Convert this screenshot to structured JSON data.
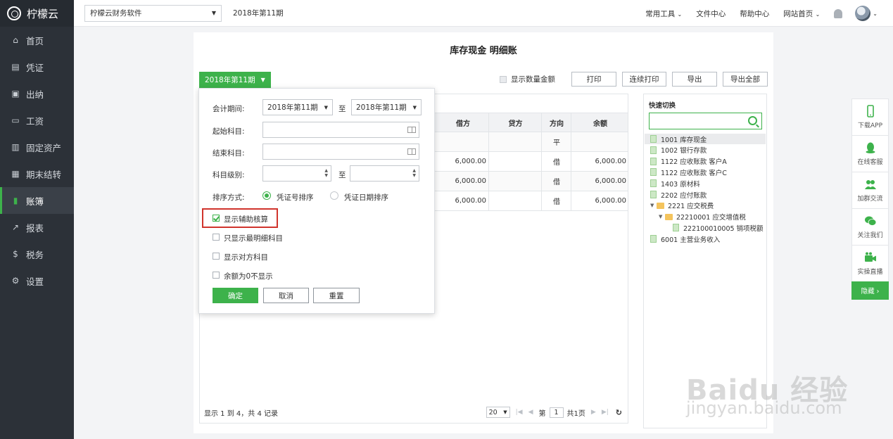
{
  "app": {
    "name": "柠檬云"
  },
  "sidebar": {
    "items": [
      {
        "label": "首页",
        "icon": "home-icon",
        "glyph": "⌂"
      },
      {
        "label": "凭证",
        "icon": "voucher-icon",
        "glyph": "▤"
      },
      {
        "label": "出纳",
        "icon": "cashier-icon",
        "glyph": "▣"
      },
      {
        "label": "工资",
        "icon": "salary-icon",
        "glyph": "▭"
      },
      {
        "label": "固定资产",
        "icon": "fixed-asset-icon",
        "glyph": "▥"
      },
      {
        "label": "期末结转",
        "icon": "period-end-icon",
        "glyph": "▦"
      },
      {
        "label": "账簿",
        "icon": "ledger-icon",
        "glyph": "▮"
      },
      {
        "label": "报表",
        "icon": "report-icon",
        "glyph": "↗"
      },
      {
        "label": "税务",
        "icon": "tax-icon",
        "glyph": "$"
      },
      {
        "label": "设置",
        "icon": "settings-icon",
        "glyph": "⚙"
      }
    ],
    "active_index": 6
  },
  "topbar": {
    "company": "柠檬云财务软件",
    "period": "2018年第11期",
    "links": [
      "常用工具",
      "文件中心",
      "帮助中心",
      "网站首页"
    ]
  },
  "page": {
    "title": "库存现金 明细账",
    "period_button": "2018年第11期",
    "show_qty_label": "显示数量金额",
    "buttons": [
      "打印",
      "连续打印",
      "导出",
      "导出全部"
    ]
  },
  "table": {
    "headers": [
      "借方",
      "贷方",
      "方向",
      "余额"
    ],
    "rows": [
      [
        "",
        "",
        "平",
        ""
      ],
      [
        "6,000.00",
        "",
        "借",
        "6,000.00"
      ],
      [
        "6,000.00",
        "",
        "借",
        "6,000.00"
      ],
      [
        "6,000.00",
        "",
        "借",
        "6,000.00"
      ]
    ],
    "footer": "显示 1 到 4，共 4 记录",
    "page_size": "20",
    "page_prefix": "第",
    "page_num": "1",
    "page_suffix": "共1页"
  },
  "quick": {
    "title": "快速切换",
    "items": [
      {
        "label": "1001 库存现金",
        "type": "doc",
        "level": 0,
        "selected": true
      },
      {
        "label": "1002 银行存款",
        "type": "doc",
        "level": 0
      },
      {
        "label": "1122 应收账款 客户A",
        "type": "doc",
        "level": 0
      },
      {
        "label": "1122 应收账款 客户C",
        "type": "doc",
        "level": 0
      },
      {
        "label": "1403 原材料",
        "type": "doc",
        "level": 0
      },
      {
        "label": "2202 应付账款",
        "type": "doc",
        "level": 0
      },
      {
        "label": "2221 应交税费",
        "type": "folder",
        "level": 0
      },
      {
        "label": "22210001 应交增值税",
        "type": "folder",
        "level": 1
      },
      {
        "label": "222100010005 销项税额",
        "type": "doc",
        "level": 2
      },
      {
        "label": "6001 主营业务收入",
        "type": "doc",
        "level": 0
      }
    ]
  },
  "filter": {
    "period_label": "会计期间:",
    "period_from": "2018年第11期",
    "to": "至",
    "period_to": "2018年第11期",
    "start_subject": "起始科目:",
    "end_subject": "结束科目:",
    "level_label": "科目级别:",
    "sort_label": "排序方式:",
    "sort_opt1": "凭证号排序",
    "sort_opt2": "凭证日期排序",
    "check_aux": "显示辅助核算",
    "check_detail": "只显示最明细科目",
    "check_opposite": "显示对方科目",
    "check_zero": "余额为0不显示",
    "btn_ok": "确定",
    "btn_cancel": "取消",
    "btn_reset": "重置"
  },
  "floatbar": {
    "items": [
      "下载APP",
      "在线客服",
      "加群交流",
      "关注我们",
      "实操直播"
    ],
    "hide": "隐藏 ›"
  },
  "watermark": {
    "main": "Baidu 经验",
    "sub": "jingyan.baidu.com"
  },
  "colors": {
    "accent": "#3db24b",
    "sidebar": "#2c3138",
    "highlight": "#d0342c"
  }
}
